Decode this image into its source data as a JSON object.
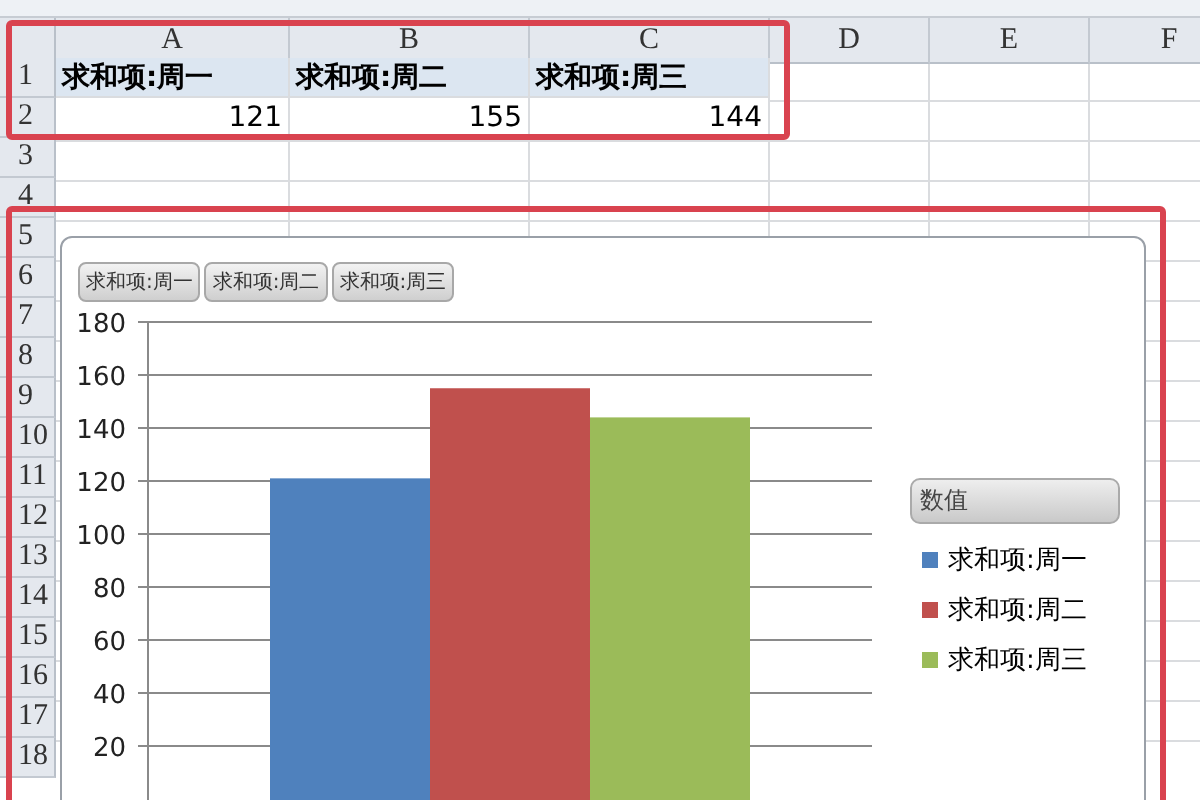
{
  "sheet": {
    "columns": [
      "A",
      "B",
      "C",
      "D",
      "E",
      "F"
    ],
    "row_numbers": [
      "1",
      "2",
      "3",
      "4",
      "5",
      "6",
      "7",
      "8",
      "9",
      "10",
      "11",
      "12",
      "13",
      "14",
      "15",
      "16",
      "17",
      "18"
    ],
    "rows": [
      [
        "求和项:周一",
        "求和项:周二",
        "求和项:周三"
      ],
      [
        "121",
        "155",
        "144"
      ]
    ]
  },
  "chart": {
    "filter_buttons": [
      "求和项:周一",
      "求和项:周二",
      "求和项:周三"
    ],
    "legend": {
      "title": "数值"
    },
    "chart_data": {
      "type": "bar",
      "grid": true,
      "ylim": [
        0,
        180
      ],
      "yticks": [
        20,
        40,
        60,
        80,
        100,
        120,
        140,
        160,
        180
      ],
      "series": [
        {
          "name": "求和项:周一",
          "color": "#4f81bd",
          "values": [
            121
          ]
        },
        {
          "name": "求和项:周二",
          "color": "#c0504d",
          "values": [
            155
          ]
        },
        {
          "name": "求和项:周三",
          "color": "#9bbb59",
          "values": [
            144
          ]
        }
      ]
    }
  }
}
